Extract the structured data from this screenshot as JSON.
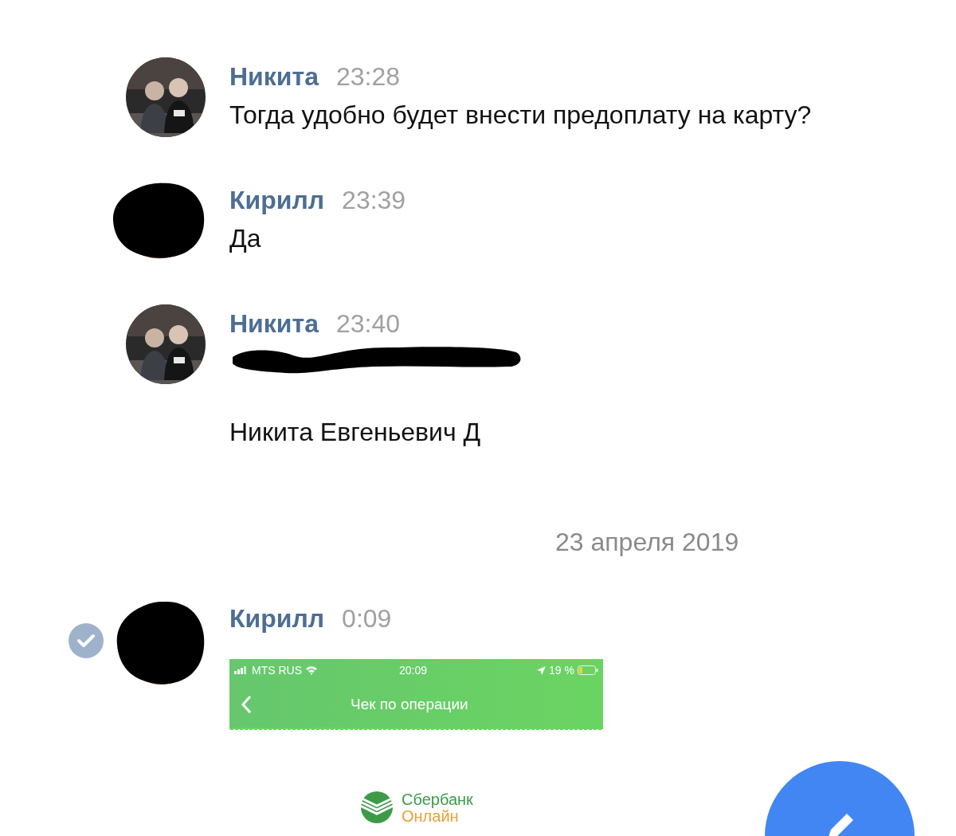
{
  "feed": [
    {
      "kind": "message",
      "author": "Никита",
      "time": "23:28",
      "avatar_redacted": false,
      "selected": false,
      "lines": [
        {
          "kind": "text",
          "text": "Тогда удобно будет внести предоплату на карту?"
        }
      ]
    },
    {
      "kind": "message",
      "author": "Кирилл",
      "time": "23:39",
      "avatar_redacted": true,
      "selected": false,
      "lines": [
        {
          "kind": "text",
          "text": "Да"
        }
      ]
    },
    {
      "kind": "message",
      "author": "Никита",
      "time": "23:40",
      "avatar_redacted": false,
      "selected": false,
      "lines": [
        {
          "kind": "redacted"
        },
        {
          "kind": "text",
          "text": "Никита Евгеньевич Д"
        }
      ]
    },
    {
      "kind": "date",
      "text": "23 апреля 2019"
    },
    {
      "kind": "message",
      "author": "Кирилл",
      "time": "0:09",
      "avatar_redacted": true,
      "selected": true,
      "attachment": {
        "kind": "screenshot",
        "carrier": "MTS RUS",
        "clock": "20:09",
        "battery": "19 %",
        "title": "Чек по операции",
        "brand": [
          "Сбербанк",
          "Онлайн"
        ]
      }
    }
  ]
}
